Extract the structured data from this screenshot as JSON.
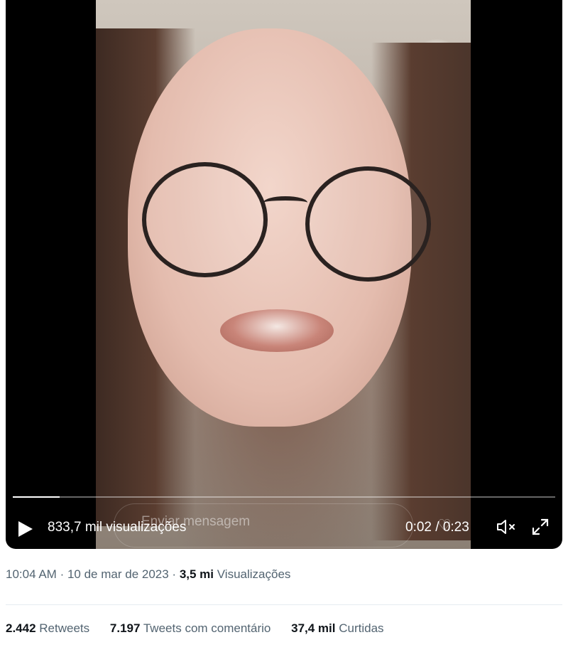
{
  "player": {
    "views_label": "833,7 mil visualizações",
    "message_placeholder": "Enviar mensagem",
    "time": "0:02 / 0:23",
    "progress": 0.087
  },
  "tweet_meta": {
    "time": "10:04 AM",
    "date": "10 de mar de 2023",
    "views_count": "3,5 mi",
    "views_label": "Visualizações",
    "separator": "·"
  },
  "stats": {
    "retweets_count": "2.442",
    "retweets_label": "Retweets",
    "quotes_count": "7.197",
    "quotes_label": "Tweets com comentário",
    "likes_count": "37,4 mil",
    "likes_label": "Curtidas"
  },
  "icons": [
    "play-icon",
    "heart-icon",
    "mute-icon",
    "fullscreen-icon"
  ],
  "colors": {
    "player_bg": "#000000",
    "meta_text": "#536471",
    "count_text": "#0f1419"
  }
}
